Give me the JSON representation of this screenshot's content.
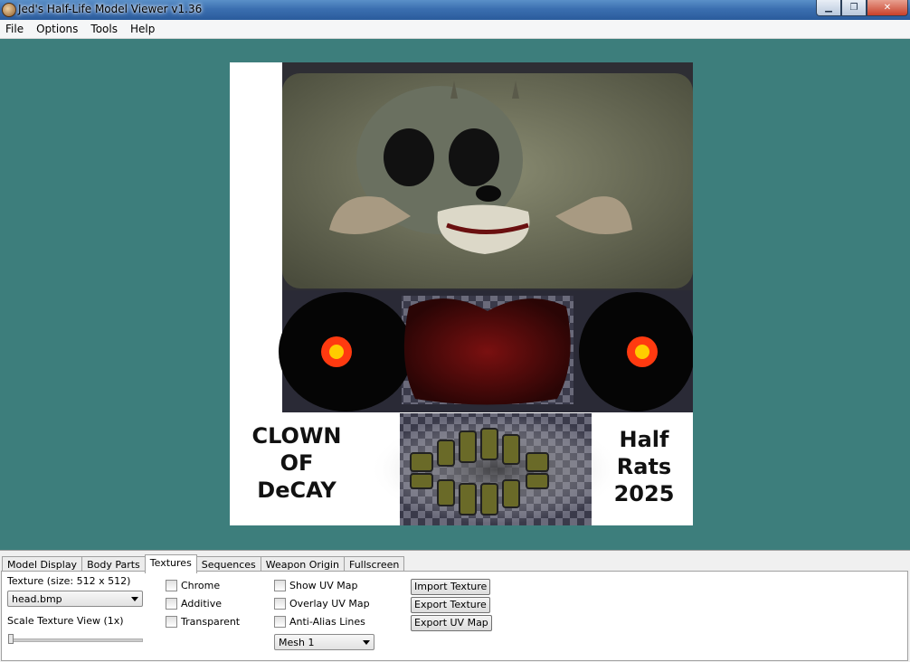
{
  "window": {
    "title": "Jed's Half-Life Model Viewer v1.36"
  },
  "menu": {
    "items": [
      "File",
      "Options",
      "Tools",
      "Help"
    ]
  },
  "colors": {
    "viewport_bg": "#3d7e7c",
    "title_bar": "#3b6fb0"
  },
  "texture_art": {
    "text_left": "CLOWN OF DeCAY",
    "text_right": "Half Rats 2025"
  },
  "tabs": [
    "Model Display",
    "Body Parts",
    "Textures",
    "Sequences",
    "Weapon Origin",
    "Fullscreen"
  ],
  "active_tab": "Textures",
  "textures": {
    "size_label": "Texture (size: 512 x 512)",
    "selected_texture": "head.bmp",
    "scale_label": "Scale Texture View (1x)",
    "checkboxes_col1": [
      "Chrome",
      "Additive",
      "Transparent"
    ],
    "checkboxes_col2": [
      "Show UV Map",
      "Overlay UV Map",
      "Anti-Alias Lines"
    ],
    "mesh_selected": "Mesh 1",
    "buttons": [
      "Import Texture",
      "Export Texture",
      "Export UV Map"
    ]
  }
}
